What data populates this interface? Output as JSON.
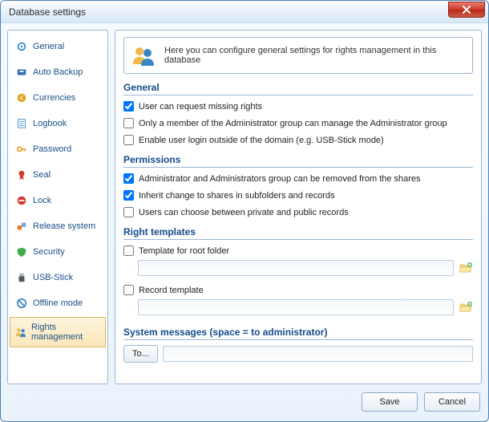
{
  "window": {
    "title": "Database settings"
  },
  "sidebar": {
    "items": [
      {
        "label": "General",
        "icon": "gear-icon",
        "color": "#3a87c8"
      },
      {
        "label": "Auto Backup",
        "icon": "backup-icon",
        "color": "#2f6db3"
      },
      {
        "label": "Currencies",
        "icon": "currency-icon",
        "color": "#e2a428"
      },
      {
        "label": "Logbook",
        "icon": "logbook-icon",
        "color": "#3a87c8"
      },
      {
        "label": "Password",
        "icon": "key-icon",
        "color": "#e8a62c"
      },
      {
        "label": "Seal",
        "icon": "seal-icon",
        "color": "#d13a2a"
      },
      {
        "label": "Lock",
        "icon": "forbid-icon",
        "color": "#d13a2a"
      },
      {
        "label": "Release system",
        "icon": "release-icon",
        "color": "#e47a2a"
      },
      {
        "label": "Security",
        "icon": "shield-icon",
        "color": "#3fae4a"
      },
      {
        "label": "USB-Stick",
        "icon": "usb-icon",
        "color": "#505a66"
      },
      {
        "label": "Offline mode",
        "icon": "offline-icon",
        "color": "#3a87c8"
      },
      {
        "label": "Rights management",
        "icon": "users-icon",
        "color": "#e6a23c",
        "selected": true
      }
    ]
  },
  "info": {
    "text": "Here you can configure general settings for rights management in this database"
  },
  "sections": {
    "general": {
      "title": "General",
      "opts": [
        {
          "label": "User can request missing rights",
          "checked": true
        },
        {
          "label": "Only a member of the Administrator group can manage the Administrator group",
          "checked": false
        },
        {
          "label": "Enable user login outside of the domain (e.g. USB-Stick mode)",
          "checked": false
        }
      ]
    },
    "permissions": {
      "title": "Permissions",
      "opts": [
        {
          "label": "Administrator and Administrators group can be removed from the shares",
          "checked": true
        },
        {
          "label": "Inherit change to shares in subfolders and records",
          "checked": true
        },
        {
          "label": "Users can choose between private and public records",
          "checked": false
        }
      ]
    },
    "right_templates": {
      "title": "Right templates",
      "root_label": "Template for root folder",
      "root_checked": false,
      "root_value": "",
      "record_label": "Record template",
      "record_checked": false,
      "record_value": ""
    },
    "system_messages": {
      "title": "System messages (space = to administrator)",
      "to_label": "To...",
      "to_value": ""
    }
  },
  "footer": {
    "save": "Save",
    "cancel": "Cancel"
  }
}
